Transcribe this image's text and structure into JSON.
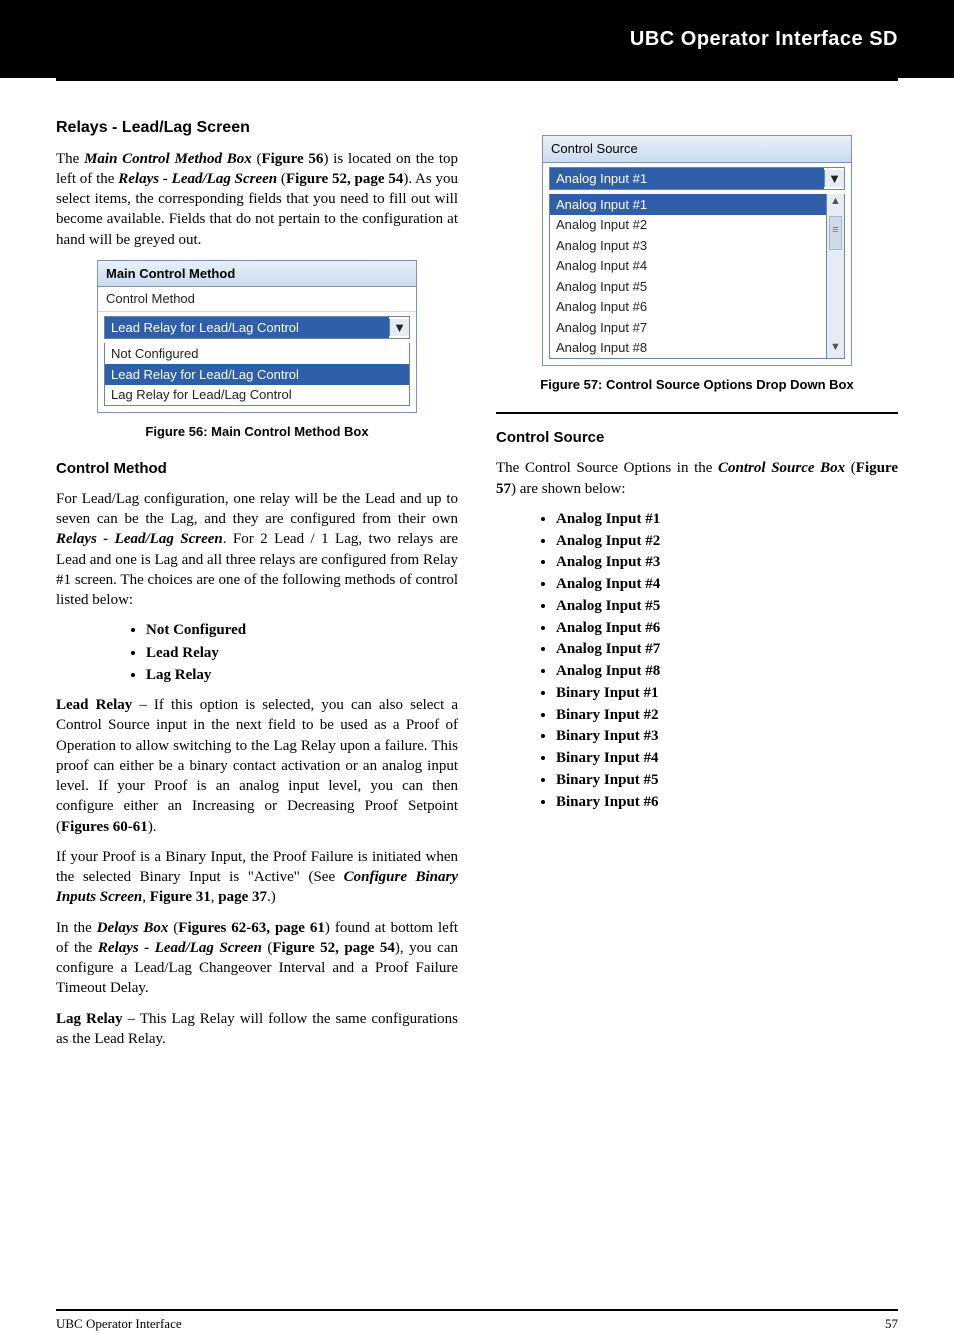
{
  "header": {
    "title": "UBC Operator Interface SD"
  },
  "left": {
    "sectionTitle": "Relays - Lead/Lag Screen",
    "p1a": "The ",
    "p1b": "Main Control Method Box",
    "p1c": " (",
    "p1d": "Figure 56",
    "p1e": ") is located on the top left of the ",
    "p1f": "Relays - Lead/Lag Screen",
    "p1g": " (",
    "p1h": "Figure 52, page 54",
    "p1i": "). As you select items, the corresponding fields that you need to fill out will become available.  Fields that do not pertain to the configuration at hand will be greyed out.",
    "ui1": {
      "title": "Main Control Method",
      "sub": "Control Method",
      "selected": "Lead Relay for Lead/Lag Control",
      "options": [
        "Not Configured",
        "Lead Relay for Lead/Lag Control",
        "Lag Relay for Lead/Lag Control"
      ],
      "optionSel": 1
    },
    "fig1": "Figure 56: Main Control Method Box",
    "ctrlHeading": "Control Method",
    "p2a": "For Lead/Lag configuration, one relay will be the Lead and up to seven can be the Lag, and they are configured from their own ",
    "p2b": "Relays - Lead/Lag Screen",
    "p2c": ". For 2 Lead / 1 Lag, two relays are Lead and one is Lag and all three relays are configured from Relay #1 screen. The choices are one of the following methods of control listed below:",
    "methods": [
      "Not Configured",
      "Lead Relay",
      "Lag Relay"
    ],
    "p3a": "Lead Relay",
    "p3b": " – If this option is selected, you can also select a Control Source input in the next field to be used as a Proof of Operation to allow switching to the Lag Relay upon a failure. This proof can either be a binary contact activation or an analog input level.  If your Proof is an analog input level, you can then configure either an Increasing or Decreasing Proof Setpoint (",
    "p3c": "Figures 60-61",
    "p3d": ").",
    "p4a": "If your Proof is a Binary Input, the Proof Failure is initiated when the selected Binary Input is \"Active\" (See ",
    "p4b": "Configure Binary Inputs Screen",
    "p4c": ", ",
    "p4d": "Figure 31",
    "p4e": ", ",
    "p4f": "page 37",
    "p4g": ".)",
    "p5a": "In the ",
    "p5b": "Delays Box",
    "p5c": " (",
    "p5d": "Figures 62-63, page 61",
    "p5e": ") found at bottom left of the ",
    "p5f": "Relays - Lead/Lag Screen",
    "p5g": " (",
    "p5h": "Figure 52, page 54",
    "p5i": "), you can configure a Lead/Lag Changeover Interval and a Proof Failure Timeout Delay.",
    "p6a": "Lag Relay",
    "p6b": " – This Lag Relay will follow the same configurations as the Lead Relay."
  },
  "right": {
    "ui2": {
      "title": "Control Source",
      "selected": "Analog Input #1",
      "options": [
        "Analog Input #1",
        "Analog Input #2",
        "Analog Input #3",
        "Analog Input #4",
        "Analog Input #5",
        "Analog Input #6",
        "Analog Input #7",
        "Analog Input #8"
      ],
      "optionSel": 0
    },
    "fig2": "Figure 57: Control Source Options Drop Down Box",
    "ctrlSourceHeading": "Control Source",
    "p1a": "The Control Source Options in the ",
    "p1b": "Control Source Box",
    "p1c": " (",
    "p1d": "Figure 57",
    "p1e": ") are shown below:",
    "sources": [
      "Analog Input #1",
      "Analog Input #2",
      "Analog Input #3",
      "Analog Input #4",
      "Analog Input #5",
      "Analog Input #6",
      "Analog Input #7",
      "Analog Input #8",
      "Binary Input #1",
      "Binary Input #2",
      "Binary Input #3",
      "Binary Input #4",
      "Binary Input #5",
      "Binary Input #6"
    ]
  },
  "footer": {
    "left": "UBC Operator Interface",
    "right": "57"
  }
}
